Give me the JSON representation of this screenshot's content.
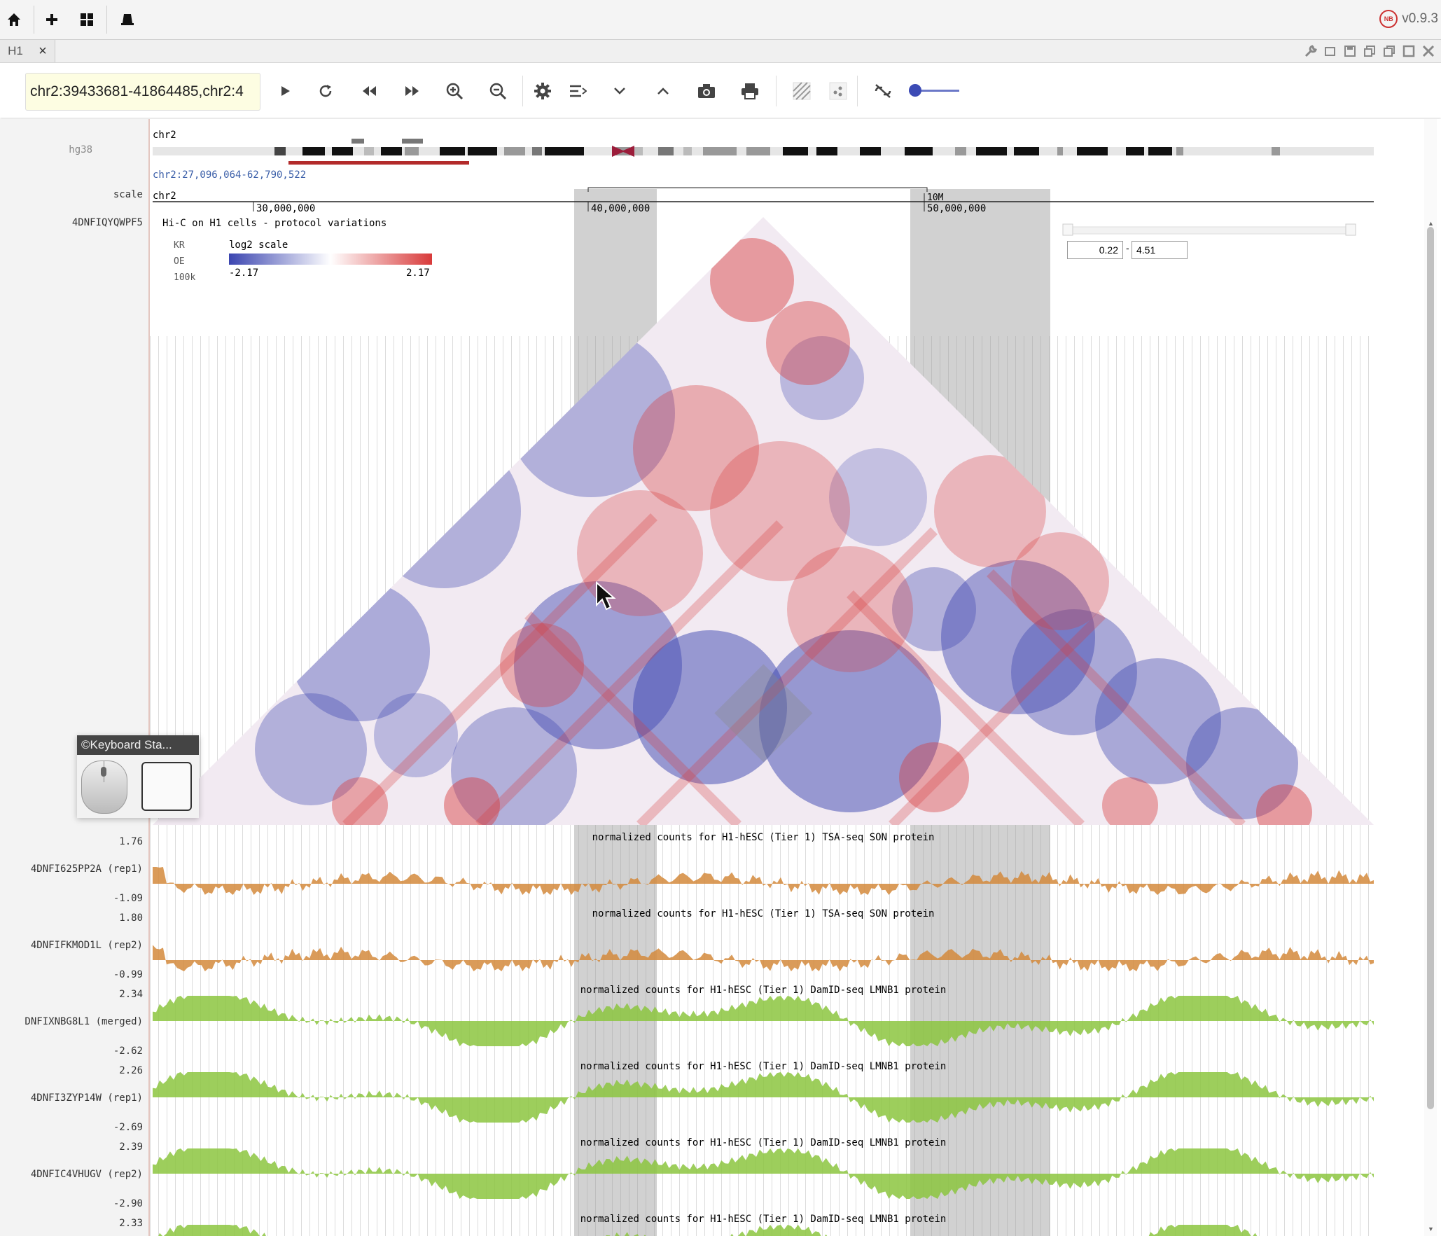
{
  "app": {
    "version": "v0.9.3",
    "logo_text": "NB",
    "topbar_icons": [
      "home-icon",
      "plus-icon",
      "grid-icon",
      "hat-icon"
    ]
  },
  "tabs": [
    {
      "label": "H1",
      "close": "×"
    }
  ],
  "toolbar": {
    "locus_value": "chr2:39433681-41864485,chr2:4",
    "tools": [
      "play-icon",
      "refresh-icon",
      "rewind-icon",
      "fast-forward-icon",
      "zoom-in-icon",
      "zoom-out-icon",
      "settings-icon",
      "menu-sort-icon",
      "chevron-down-icon",
      "chevron-up-icon",
      "camera-icon",
      "print-icon",
      "hatch-icon",
      "scatter-icon",
      "unlink-icon"
    ],
    "zoom_slider_fraction": 0.0
  },
  "genome": {
    "assembly": "hg38",
    "chrom_label": "chr2",
    "region_text": "chr2:27,096,064-62,790,522"
  },
  "scale": {
    "label": "scale",
    "chrom": "chr2",
    "ticks": [
      "30,000,000",
      "40,000,000",
      "50,000,000"
    ],
    "small_tick": "10M"
  },
  "hic": {
    "track_id": "4DNFIQYQWPF5",
    "title": "Hi-C on H1 cells - protocol variations",
    "norm": "KR",
    "mode": "OE",
    "resolution": "100k",
    "scale_label": "log2 scale",
    "min": "-2.17",
    "max": "2.17",
    "range_low": "0.22",
    "range_high": "4.51",
    "range_sep": "-"
  },
  "tracks": [
    {
      "id": "4DNFI625PP2A  (rep1)",
      "title": "normalized counts for H1-hESC (Tier 1) TSA-seq SON protein",
      "max": "1.76",
      "min": "-1.09",
      "color": "#d48a3c"
    },
    {
      "id": "4DNFIFKMOD1L  (rep2)",
      "title": "normalized counts for H1-hESC (Tier 1) TSA-seq SON protein",
      "max": "1.80",
      "min": "-0.99",
      "color": "#d48a3c"
    },
    {
      "id": "DNFIXNBG8L1  (merged)",
      "title": "normalized counts for H1-hESC (Tier 1) DamID-seq LMNB1 protein",
      "max": "2.34",
      "min": "-2.62",
      "color": "#8cc63f"
    },
    {
      "id": "4DNFI3ZYP14W  (rep1)",
      "title": "normalized counts for H1-hESC (Tier 1) DamID-seq LMNB1 protein",
      "max": "2.26",
      "min": "-2.69",
      "color": "#8cc63f"
    },
    {
      "id": "4DNFIC4VHUGV  (rep2)",
      "title": "normalized counts for H1-hESC (Tier 1) DamID-seq LMNB1 protein",
      "max": "2.39",
      "min": "-2.90",
      "color": "#8cc63f"
    },
    {
      "id": "",
      "title": "normalized counts for H1-hESC (Tier 1) DamID-seq LMNB1 protein",
      "max": "2.33",
      "min": "",
      "color": "#8cc63f"
    }
  ],
  "keyboard_status": {
    "title": "©Keyboard Sta..."
  },
  "colors": {
    "blue": "#3b45b0",
    "red": "#d83a3a",
    "highlight": "#9a9a9a"
  }
}
